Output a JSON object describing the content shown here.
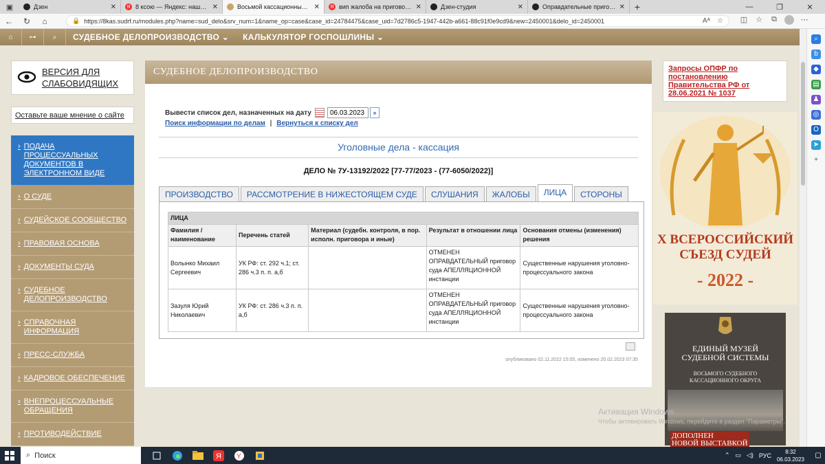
{
  "browser": {
    "tabs": [
      {
        "title": "Дзен",
        "active": false
      },
      {
        "title": "8 ксою — Яндекс: нашлось 6 м",
        "active": false
      },
      {
        "title": "Восьмой кассационный суд об",
        "active": true
      },
      {
        "title": "вип жалоба на приговор — Ян",
        "active": false
      },
      {
        "title": "Дзен-студия",
        "active": false
      },
      {
        "title": "Оправдательные приговоры по",
        "active": false
      }
    ],
    "url": "https://8kas.sudrf.ru/modules.php?name=sud_delo&srv_num=1&name_op=case&case_id=24784475&case_uid=7d2786c5-1947-442b-a661-88c91f0e9cd9&new=2450001&delo_id=2450001"
  },
  "site_nav": {
    "items": [
      "СУДЕБНОЕ ДЕЛОПРОИЗВОДСТВО ⌄",
      "КАЛЬКУЛЯТОР ГОСПОШЛИНЫ ⌄"
    ]
  },
  "left": {
    "vision_line1": "ВЕРСИЯ ДЛЯ",
    "vision_line2": "СЛАБОВИДЯЩИХ",
    "feedback": "Оставьте ваше мнение о сайте",
    "menu": [
      "ПОДАЧА ПРОЦЕССУАЛЬНЫХ ДОКУМЕНТОВ В ЭЛЕКТРОННОМ ВИДЕ",
      "О СУДЕ",
      "СУДЕЙСКОЕ СООБЩЕСТВО",
      "ПРАВОВАЯ ОСНОВА",
      "ДОКУМЕНТЫ СУДА",
      "СУДЕБНОЕ ДЕЛОПРОИЗВОДСТВО",
      "СПРАВОЧНАЯ ИНФОРМАЦИЯ",
      "ПРЕСС-СЛУЖБА",
      "КАДРОВОЕ ОБЕСПЕЧЕНИЕ",
      "ВНЕПРОЦЕССУАЛЬНЫЕ ОБРАЩЕНИЯ",
      "ПРОТИВОДЕЙСТВИЕ"
    ]
  },
  "main": {
    "header": "СУДЕБНОЕ ДЕЛОПРОИЗВОДСТВО",
    "date_label": "Вывести список дел, назначенных на дату",
    "date_value": "06.03.2023",
    "link_search": "Поиск информации по делам",
    "link_sep": "|",
    "link_back": "Вернуться к списку дел",
    "subtitle": "Уголовные дела - кассация",
    "case_number": "ДЕЛО № 7У-13192/2022 [77-77/2023 - (77-6050/2022)]",
    "tabs": [
      "ПРОИЗВОДСТВО",
      "РАССМОТРЕНИЕ В НИЖЕСТОЯЩЕМ СУДЕ",
      "СЛУШАНИЯ",
      "ЖАЛОБЫ",
      "ЛИЦА",
      "СТОРОНЫ"
    ],
    "active_tab": "ЛИЦА",
    "table": {
      "caption": "ЛИЦА",
      "headers": [
        "Фамилия / наименование",
        "Перечень статей",
        "Материал (судебн. контроля, в пор. исполн. приговора и иные)",
        "Результат в отношении лица",
        "Основания отмены (изменения) решения"
      ],
      "rows": [
        [
          "Волынко Михаил Сергеевич",
          "УК РФ: ст. 292 ч.1; ст. 286 ч.3 п. п. а,б",
          "",
          "ОТМЕНЕН ОПРАВДАТЕЛЬНЫЙ приговор суда АПЕЛЛЯЦИОННОЙ инстанции",
          "Существенные нарушения уголовно-процессуального закона"
        ],
        [
          "Зазуля Юрий Николаевич",
          "УК РФ: ст. 286 ч.3 п. п. а,б",
          "",
          "ОТМЕНЕН ОПРАВДАТЕЛЬНЫЙ приговор суда АПЕЛЛЯЦИОННОЙ инстанции",
          "Существенные нарушения уголовно-процессуального закона"
        ]
      ]
    },
    "published": "опубликовано 02.11.2022 15:05, изменено 20.02.2023 07:35"
  },
  "right": {
    "opfr_link": "Запросы ОПФР по постановлению Правительства РФ от 28.06.2021 № 1037",
    "congress_line1": "X ВСЕРОССИЙСКИЙ",
    "congress_line2": "СЪЕЗД СУДЕЙ",
    "congress_year": "- 2022 -",
    "museum_line1": "ЕДИНЫЙ МУЗЕЙ",
    "museum_line2": "СУДЕБНОЙ СИСТЕМЫ",
    "museum_sub1": "ВОСЬМОГО СУДЕБНОГО",
    "museum_sub2": "КАССАЦИОННОГО ОКРУГА",
    "museum_new1": "ДОПОЛНЕН",
    "museum_new2": "НОВОЙ ВЫСТАВКОЙ"
  },
  "watermark": {
    "line1": "Активация Windows",
    "line2": "Чтобы активировать Windows, перейдите в раздел \"Параметры\"."
  },
  "taskbar": {
    "search_placeholder": "Поиск",
    "lang": "РУС",
    "time": "8:32",
    "date": "06.03.2023"
  },
  "colors": {
    "brown_nav": "#b39b74",
    "active_menu_blue": "#2f77c3",
    "link_blue": "#2b5da8",
    "opfr_red": "#b22222",
    "congress_red": "#b33a1c"
  }
}
